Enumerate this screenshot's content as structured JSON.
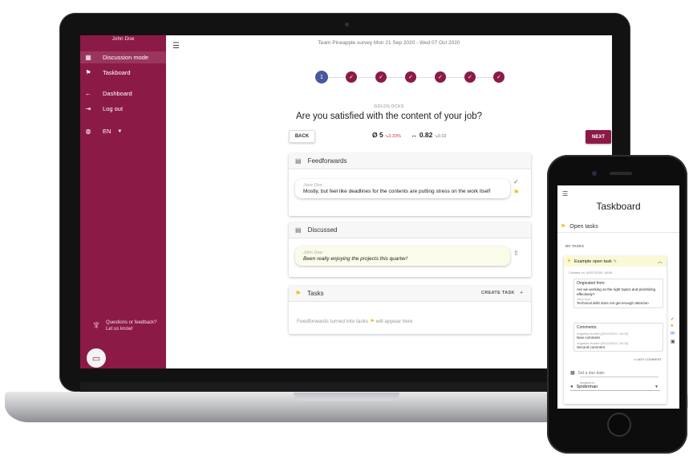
{
  "laptop": {
    "sidebar": {
      "user": "John Doe",
      "items": [
        {
          "label": "Discussion mode",
          "icon": "calendar-icon"
        },
        {
          "label": "Taskboard",
          "icon": "flag-icon"
        },
        {
          "label": "Dashboard",
          "icon": "arrow-left-icon"
        },
        {
          "label": "Log out",
          "icon": "logout-icon"
        }
      ],
      "language": "EN",
      "feedback_line1": "Questions or feedback?",
      "feedback_line2": "Let us know!"
    },
    "survey": {
      "title": "Team Pineapple survey Mon 21 Sep 2020 - Wed 07 Oct 2020",
      "current_step": "1",
      "category": "GOLDILOCKS",
      "question": "Are you satisfied with the content of your job?",
      "back_label": "BACK",
      "next_label": "NEXT",
      "avg_symbol": "Ø",
      "avg_value": "5",
      "avg_delta": "↘3.33%",
      "spread_symbol": "↔",
      "spread_value": "0.82",
      "spread_delta": "↘0.02"
    },
    "feedforwards": {
      "header": "Feedforwards",
      "author": "Jane Doe:",
      "text": "Mostly, but feel like deadlines for the contents are putting stress on the work itself"
    },
    "discussed": {
      "header": "Discussed",
      "author": "John Doe:",
      "text": "Been really enjoying the projects this quarter!"
    },
    "tasks": {
      "header": "Tasks",
      "create_label": "CREATE TASK",
      "empty_text_before": "Feedforwards turned into tasks",
      "empty_text_after": "will appear here"
    },
    "colors": {
      "brand": "#8c1a47",
      "step_current": "#4a58a0",
      "flag": "#e7c315"
    }
  },
  "phone": {
    "title": "Taskboard",
    "open_tasks": "Open tasks",
    "my_tasks": "MY TASKS",
    "task_title": "Example open task",
    "created_on": "Created on: 00/07/2020, 18:09",
    "originated_label": "Originated from:",
    "originated_question": "Are we working on the right topics and prioritizing effectively?",
    "originated_author": "John Doe",
    "originated_text": "Technical debt does not get enough attention",
    "comments_label": "Comments:",
    "comments": [
      {
        "author": "Angelika Hobert [20/10/2020, 16:02]",
        "text": "New comment"
      },
      {
        "author": "Angelika Hobert [20/10/2020, 16:03]",
        "text": "Second comment"
      }
    ],
    "add_comment": "ADD COMMENT",
    "due_date": "Set a due date:",
    "assigned_label": "Assigned to",
    "assigned_to": "Spiderman"
  }
}
